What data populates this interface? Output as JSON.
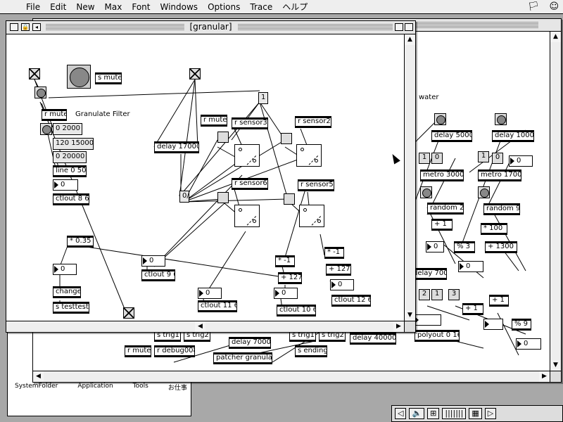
{
  "menubar": {
    "apple": "",
    "items": [
      "File",
      "Edit",
      "New",
      "Max",
      "Font",
      "Windows",
      "Options",
      "Trace",
      "ヘルプ"
    ]
  },
  "finder": {
    "icons": [
      "SystemFolder",
      "Application",
      "Tools",
      "お仕事"
    ]
  },
  "back_window": {
    "comment": "water",
    "objects": [
      "delay 5000",
      "delay 1000",
      "metro 3000",
      "metro 1700",
      "random 2",
      "random 9",
      "+ 1",
      "* 100",
      "+ 1300",
      "% 3",
      "delay 700",
      "% 9",
      "polyout 0 16",
      "delay 40000",
      "delay 7000",
      "s trig1",
      "s trig2",
      "s trig1",
      "s trig2",
      "r mute",
      "r debug008",
      "s ending",
      "patcher granular"
    ],
    "numbers": [
      "1",
      "0",
      "1",
      "0",
      "0",
      "0",
      "0",
      "2",
      "1",
      "3",
      "+ 1",
      "+ 1",
      "0"
    ]
  },
  "main_window": {
    "title": "[granular]",
    "comment": "Granulate Filter",
    "objects": {
      "s_mute": "s mute",
      "r_mute1": "r mute",
      "msg_0_2000": "0 2000",
      "msg_120_15000": "120 15000",
      "msg_0_20000": "0 20000",
      "line": "line 0 50",
      "ctlout86": "ctlout 8 6",
      "r_mute2": "r mute",
      "delay17000": "delay 17000",
      "r_sensor3": "r sensor3",
      "r_sensor2": "r sensor2",
      "r_sensor6": "r sensor6",
      "r_sensor5": "r sensor5",
      "mul035": "* 0.35",
      "change": "change",
      "s_testtest": "s testtest",
      "ctlout96": "ctlout 9 6",
      "ctlout116": "ctlout 11 6",
      "mul_neg1_a": "* -1",
      "mul_neg1_b": "* -1",
      "add127_a": "+ 127",
      "add127_b": "+ 127",
      "ctlout106": "ctlout 10 6",
      "ctlout126": "ctlout 12 6",
      "msg_1": "1",
      "msg_0": "0/"
    },
    "numbers": [
      "0",
      "0",
      "0",
      "0",
      "0",
      "0"
    ]
  },
  "strip": {
    "items": [
      "◁",
      "🔈",
      "⊞",
      "|||||||",
      "▦",
      "▷"
    ]
  }
}
